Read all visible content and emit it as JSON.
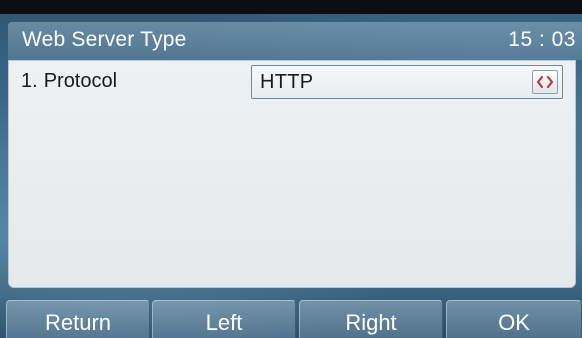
{
  "header": {
    "title": "Web Server Type",
    "time": "15 : 03"
  },
  "settings": {
    "rows": [
      {
        "index": "1.",
        "label": "Protocol",
        "value": "HTTP",
        "control_icon": "left-right-arrows-icon"
      }
    ]
  },
  "softkeys": {
    "return_label": "Return",
    "left_label": "Left",
    "right_label": "Right",
    "ok_label": "OK"
  },
  "colors": {
    "panel_background": "#e9edf0",
    "accent_border": "#6f8798",
    "arrow_icon": "#c0392b",
    "text_light": "#ffffff",
    "text_dark": "#1b1b1b"
  }
}
